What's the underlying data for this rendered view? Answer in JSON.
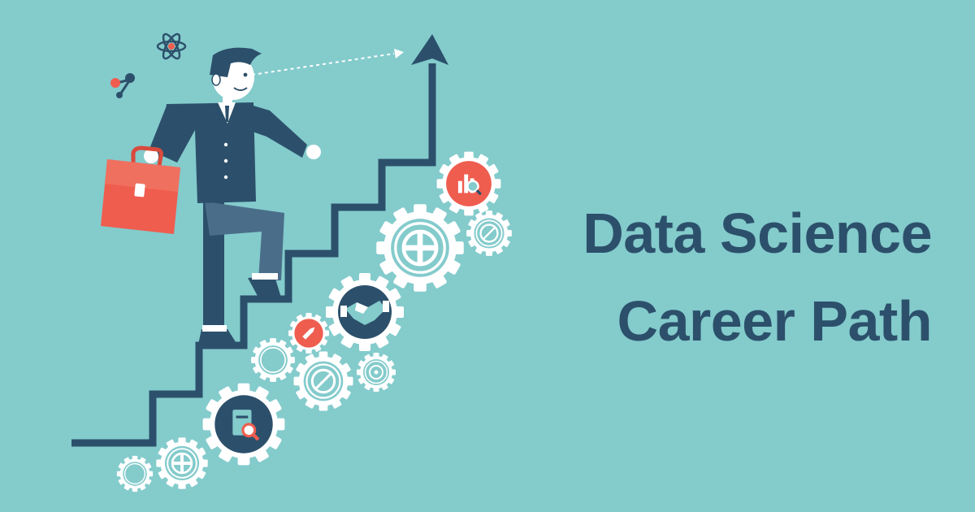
{
  "headline": {
    "line1": "Data Science",
    "line2": "Career Path"
  },
  "colors": {
    "background": "#84cbcc",
    "navy": "#2c506b",
    "coral": "#ef5d4f",
    "gear": "#ffffff",
    "trouser": "#4a6e8a"
  },
  "icons": [
    "atom-icon",
    "molecule-icon",
    "arrow-up-icon",
    "chart-magnifier-icon",
    "handshake-icon",
    "pencil-icon",
    "document-search-icon",
    "plus-icon",
    "no-entry-icon",
    "briefcase-icon"
  ]
}
